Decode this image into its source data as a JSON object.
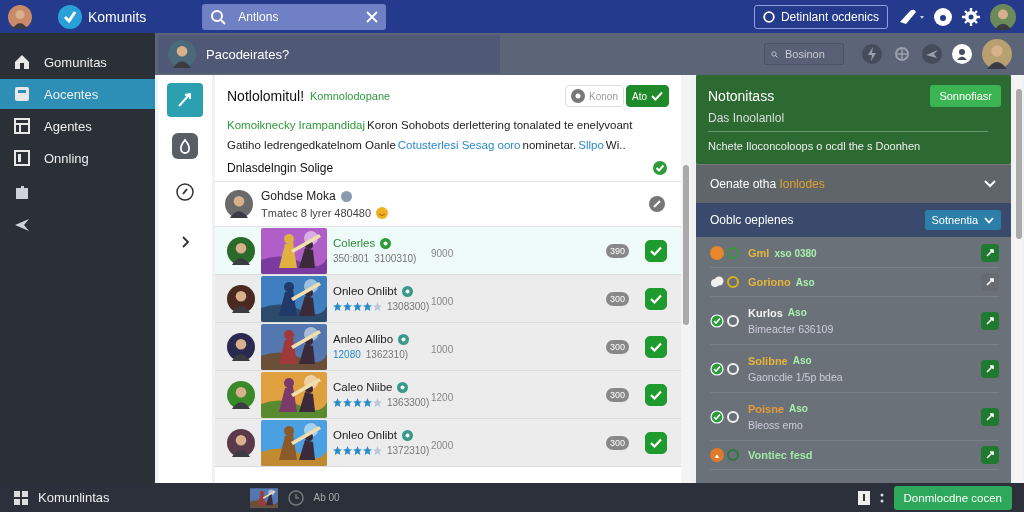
{
  "topbar": {
    "app_name": "Komunits",
    "search": {
      "value": "Antlons"
    },
    "status_button": "Detinlant ocdenics"
  },
  "sidebar": {
    "items": [
      {
        "label": "Gomunitas",
        "selected": false
      },
      {
        "label": "Aocentes",
        "selected": true
      },
      {
        "label": "Agentes",
        "selected": false
      },
      {
        "label": "Onnling",
        "selected": false
      }
    ]
  },
  "header": {
    "title": "Pacodeirates?",
    "search": {
      "placeholder": "Bosinon"
    }
  },
  "rail": {
    "items": [
      {
        "kind": "pen",
        "selected": true
      },
      {
        "kind": "drop",
        "selected": false
      },
      {
        "kind": "compass",
        "selected": false
      },
      {
        "kind": "chevron",
        "selected": false
      }
    ]
  },
  "post": {
    "title": "Notlolomitul!",
    "tag": "Komnolodopane",
    "toggle": [
      {
        "label": "Konon",
        "selected": false
      },
      {
        "label": "Ato",
        "selected": true
      }
    ],
    "paragraphs": [
      [
        {
          "text": "Komoiknecky Irampandidaj",
          "color": "#2e9a3a"
        },
        {
          "text": " Koron Sohobots derlettering tonalated te enelyvoant",
          "color": "#222222"
        }
      ],
      [
        {
          "text": "Gatiho ledrengedkatelnom Oanle ",
          "color": "#222222"
        },
        {
          "text": "Cotusterlesi Sesag ooro",
          "color": "#2a8ac8"
        },
        {
          "text": "nominetar. ",
          "color": "#222222"
        },
        {
          "text": "Sllpo",
          "color": "#2a8ac8"
        },
        {
          "text": " Wi..",
          "color": "#222222"
        }
      ]
    ],
    "section": "Dnlasdelngin Solige",
    "user": {
      "name": "Gohdse Moka",
      "status": "Tmatec 8 lyrer 480480"
    },
    "rows": [
      {
        "name": "Colerles",
        "selected": true,
        "kind": "text",
        "meta": "350:801",
        "code": "3100310)",
        "amount": "9000",
        "count": "390",
        "checked": true
      },
      {
        "name": "Onleo Onlibt",
        "selected": false,
        "kind": "stars",
        "stars": 4,
        "code": "1308300)",
        "amount": "1000",
        "count": "300",
        "checked": true
      },
      {
        "name": "Anleo Allibo",
        "selected": false,
        "kind": "text",
        "meta": "12080",
        "code": "1362310)",
        "amount": "1000",
        "count": "300",
        "checked": true
      },
      {
        "name": "Caleo Niibe",
        "selected": false,
        "kind": "stars",
        "stars": 4,
        "code": "1363300)",
        "amount": "1200",
        "count": "300",
        "checked": true
      },
      {
        "name": "Onleo Onlibt",
        "selected": false,
        "kind": "stars",
        "stars": 4,
        "code": "1372310)",
        "amount": "2000",
        "count": "300",
        "checked": true
      }
    ]
  },
  "panel": {
    "card": {
      "title": "Notonitass",
      "button": "Sonnofiasr",
      "subtitle": "Das Inoolanlol",
      "text": "Nchete Iloconcoloops o ocdl the s Doonhen"
    },
    "accordion": {
      "label": "Oenate otha",
      "highlight": "Ionlodes"
    },
    "list_header": {
      "title": "Ooblc oeplenes",
      "dropdown": "Sotnentia"
    },
    "items": [
      {
        "kind": "dot",
        "title": "Gml",
        "color": "#e6b43a",
        "tag": "xso 0380",
        "active": true
      },
      {
        "kind": "cloud",
        "title": "Goriono",
        "color": "#e6b43a",
        "tag": "Aso",
        "active": false
      },
      {
        "kind": "check",
        "title": "Kurlos",
        "color": "#f2f2f2",
        "tag": "Aso",
        "detail": "Bimeacter 636109",
        "active": true
      },
      {
        "kind": "check",
        "title": "Solibne",
        "color": "#e6b43a",
        "tag": "Aso",
        "detail": "Gaoncdie 1/5p bdea",
        "active": true
      },
      {
        "kind": "check",
        "title": "Poisne",
        "color": "#e89a3a",
        "tag": "Aso",
        "detail": "Bleoss emo",
        "active": true
      },
      {
        "kind": "flame",
        "title": "Vontiec fesd",
        "color": "#9fe8a6",
        "active": true
      }
    ]
  },
  "footer": {
    "app_name": "Komunlintas",
    "status": "Ab 00",
    "button": "Donmlocdne cocen"
  }
}
